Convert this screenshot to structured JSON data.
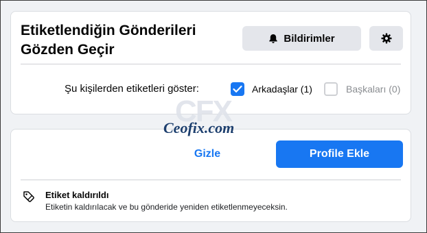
{
  "header": {
    "title": "Etiketlendiğin Gönderileri Gözden Geçir",
    "notifications_label": "Bildirimler",
    "notifications_icon": "bell-icon",
    "settings_icon": "gear-icon"
  },
  "filter": {
    "label": "Şu kişilerden etiketleri göster:",
    "options": [
      {
        "label": "Arkadaşlar (1)",
        "checked": true
      },
      {
        "label": "Başkaları (0)",
        "checked": false
      }
    ]
  },
  "watermark": {
    "logo_text": "CFX",
    "text": "Ceofix.com"
  },
  "actions": {
    "hide_label": "Gizle",
    "add_label": "Profile Ekle"
  },
  "notice": {
    "icon": "tag-icon",
    "title": "Etiket kaldırıldı",
    "text": "Etiketin kaldırılacak ve bu gönderide yeniden etiketlenmeyeceksin."
  },
  "colors": {
    "accent": "#1877f2",
    "background": "#f0f2f5",
    "button_gray": "#e4e6eb"
  }
}
